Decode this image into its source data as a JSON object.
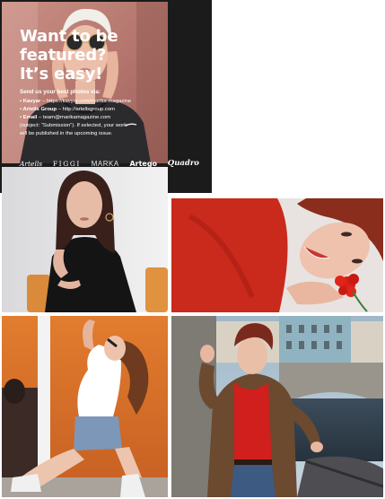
{
  "panel": {
    "headline": [
      "Want to be",
      "featured?",
      "It’s easy!"
    ],
    "intro": "Send us your best photos via:",
    "channels": [
      {
        "name": "• Kavyar",
        "detail": " – https://kavyar.com/marika-magazine"
      },
      {
        "name": "• Artells Group",
        "detail": " – http://artellsgroup.com"
      },
      {
        "name": "• Email",
        "detail": " – team@marikamagazine.com"
      }
    ],
    "note_lines": [
      "(subject: “Submission”). If selected, your work",
      "will be published in the upcoming issue."
    ],
    "logos": [
      "Artells",
      "FIGGI",
      "MARKA",
      "Artego",
      "Quadro"
    ]
  },
  "colors": {
    "panel_bg": "#1b1b1b",
    "text": "#ffffff",
    "accent_red": "#d52a1e"
  }
}
